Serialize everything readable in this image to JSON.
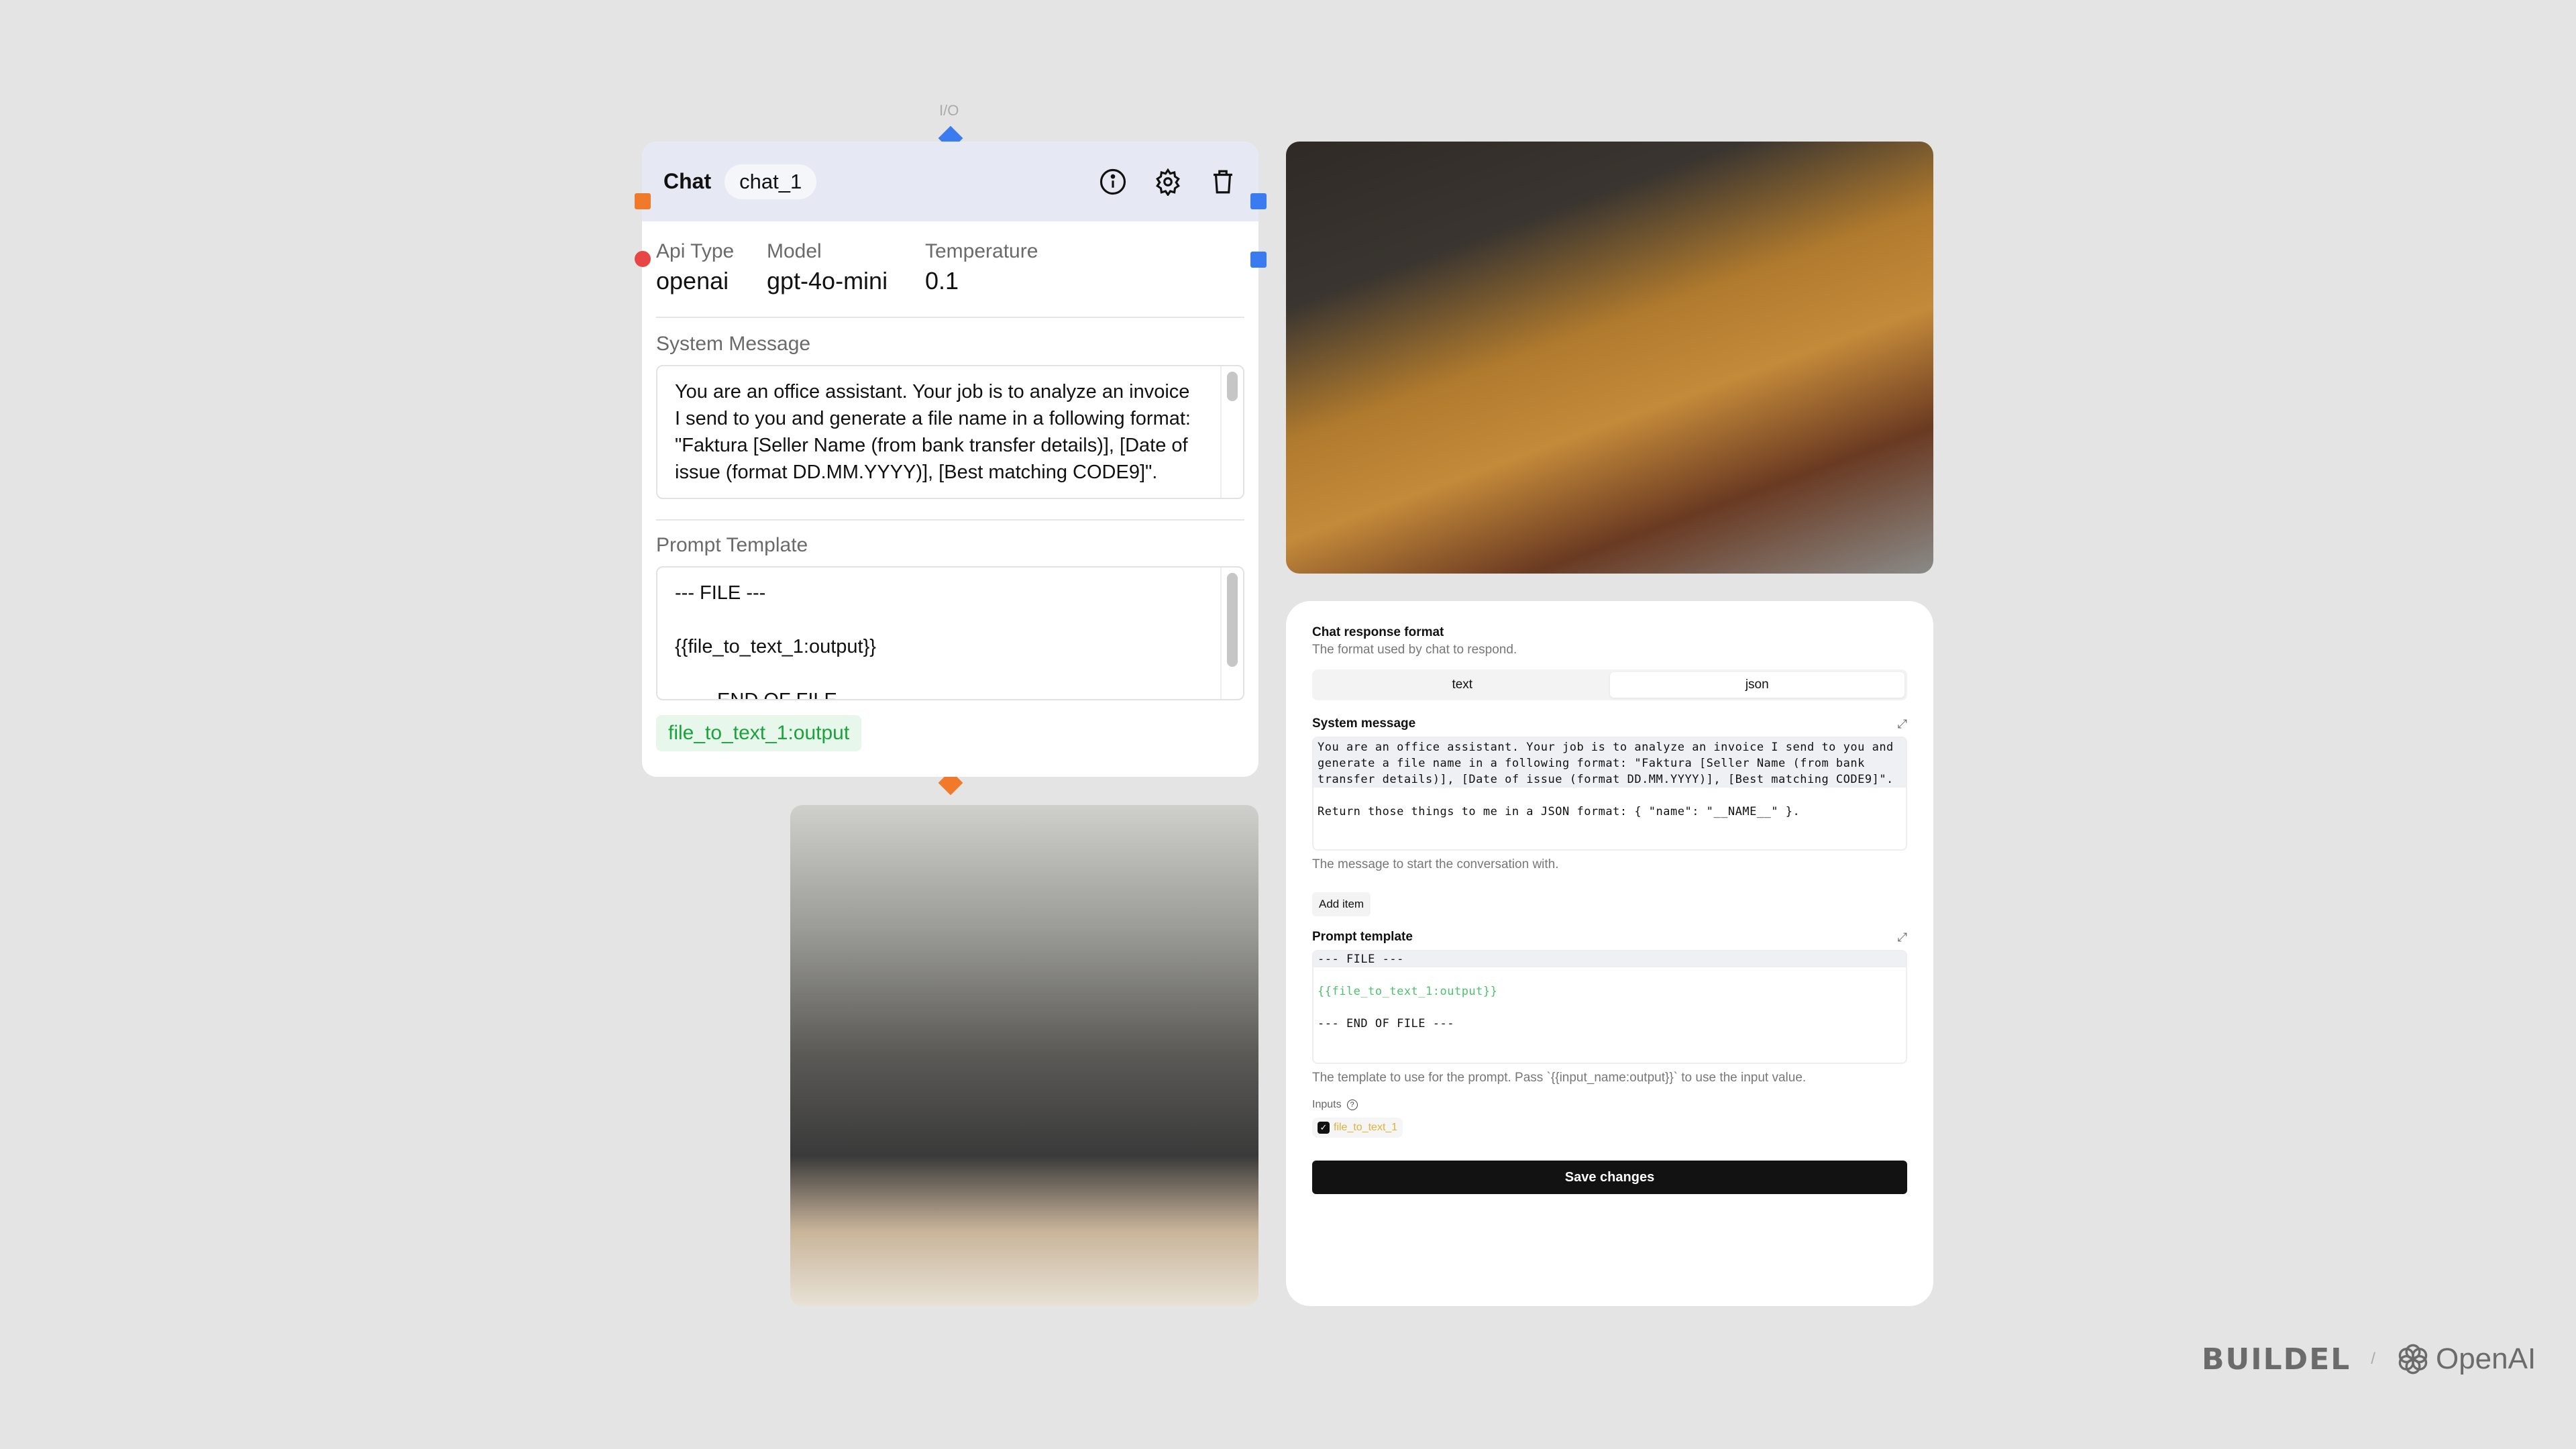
{
  "node": {
    "io_label": "I/O",
    "title": "Chat",
    "name": "chat_1",
    "props": [
      {
        "label": "Api Type",
        "value": "openai"
      },
      {
        "label": "Model",
        "value": "gpt-4o-mini"
      },
      {
        "label": "Temperature",
        "value": "0.1"
      }
    ],
    "system_message_label": "System Message",
    "system_message": "You are an office assistant. Your job is to analyze an invoice I send to you and generate a file name in a following format: \"Faktura [Seller Name (from bank transfer details)], [Date of issue (format DD.MM.YYYY)], [Best matching CODE9]\".",
    "prompt_template_label": "Prompt Template",
    "prompt_lines": [
      "--- FILE ---",
      "",
      "{{file_to_text_1:output}}",
      "",
      "--- END OF FILE ---"
    ],
    "input_tag": "file_to_text_1:output",
    "colors": {
      "header": "#e6e9f4",
      "input_handle": "#f07a2a",
      "output_handle": "#3b7bf0",
      "io_handle": "#3b7bf0",
      "error_dot": "#e84545"
    }
  },
  "panel": {
    "response_format_title": "Chat response format",
    "response_format_desc": "The format used by chat to respond.",
    "formats": [
      "text",
      "json"
    ],
    "selected_format": "json",
    "system_message_title": "System message",
    "system_message_lines": [
      "You are an office assistant. Your job is to analyze an invoice I send to you and generate a file name in a following format: \"Faktura [Seller Name (from bank transfer details)], [Date of issue (format DD.MM.YYYY)], [Best matching CODE9]\".",
      "",
      "Return those things to me in a JSON format: { \"name\": \"__NAME__\" }."
    ],
    "system_message_hint": "The message to start the conversation with.",
    "add_item": "Add item",
    "prompt_template_title": "Prompt template",
    "prompt_lines": [
      "--- FILE ---",
      "",
      "{{file_to_text_1:output}}",
      "",
      "--- END OF FILE ---"
    ],
    "prompt_hint": "The template to use for the prompt. Pass `{{input_name:output}}` to use the input value.",
    "inputs_label": "Inputs",
    "input_chip": "file_to_text_1",
    "input_checked": true,
    "save": "Save changes"
  },
  "logos": {
    "buildel": "BUILDEL",
    "separator": "/",
    "openai": "OpenAI"
  }
}
